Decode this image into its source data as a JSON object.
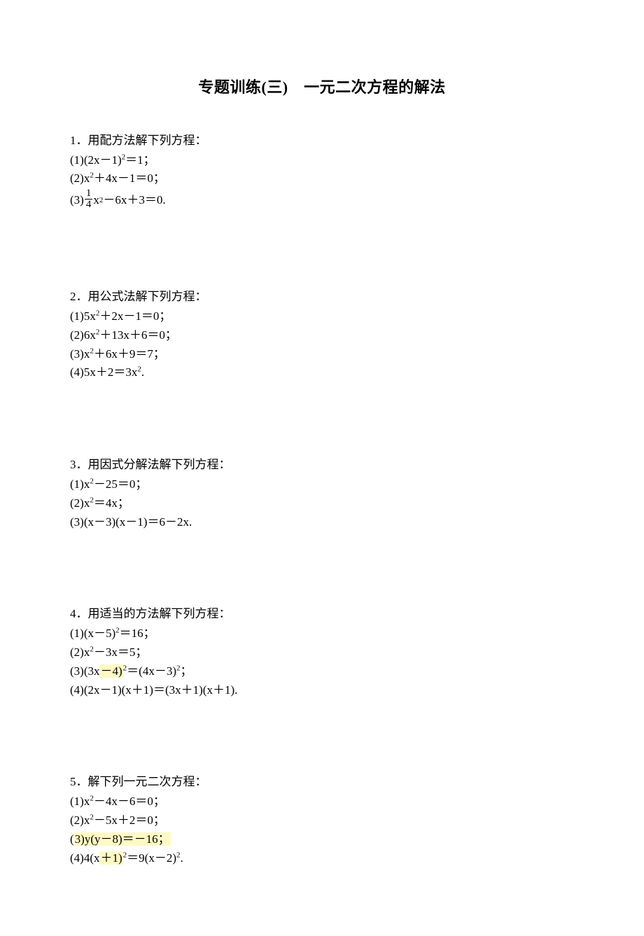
{
  "title": "专题训练(三)　一元二次方程的解法",
  "q1": {
    "head": "1．用配方法解下列方程：",
    "l1a": "(1)(2x－1)",
    "l1b": "＝1；",
    "l2a": "(2)x",
    "l2b": "＋4x－1＝0；",
    "l3a": "(3)",
    "l3num": "1",
    "l3den": "4",
    "l3b": "x",
    "l3c": "－6x＋3＝0."
  },
  "q2": {
    "head": "2．用公式法解下列方程：",
    "l1a": "(1)5x",
    "l1b": "＋2x－1＝0；",
    "l2a": "(2)6x",
    "l2b": "＋13x＋6＝0；",
    "l3a": "(3)x",
    "l3b": "＋6x＋9＝7；",
    "l4a": "(4)5x＋2＝3x",
    "l4b": "."
  },
  "q3": {
    "head": "3．用因式分解法解下列方程：",
    "l1a": "(1)x",
    "l1b": "－25＝0；",
    "l2a": "(2)x",
    "l2b": "＝4x；",
    "l3": "(3)(x－3)(x－1)＝6－2x."
  },
  "q4": {
    "head": "4．用适当的方法解下列方程：",
    "l1a": "(1)(x－5)",
    "l1b": "＝16；",
    "l2a": "(2)x",
    "l2b": "－3x＝5；",
    "l3a": "(3)(3x",
    "l3mid": "－4)",
    "l3b": "＝(4x－3)",
    "l3c": "；",
    "l4": "(4)(2x－1)(x＋1)＝(3x＋1)(x＋1)."
  },
  "q5": {
    "head": "5．解下列一元二次方程：",
    "l1a": "(1)x",
    "l1b": "－4x－6＝0；",
    "l2a": "(2)x",
    "l2b": "－5x＋2＝0；",
    "l3a": "(",
    "l3b": "3)y(y－8)＝－16；",
    "l4a": "(4)4(x",
    "l4mid": "＋1)",
    "l4b": "＝9(x－2)",
    "l4c": "."
  },
  "sup2": "2"
}
